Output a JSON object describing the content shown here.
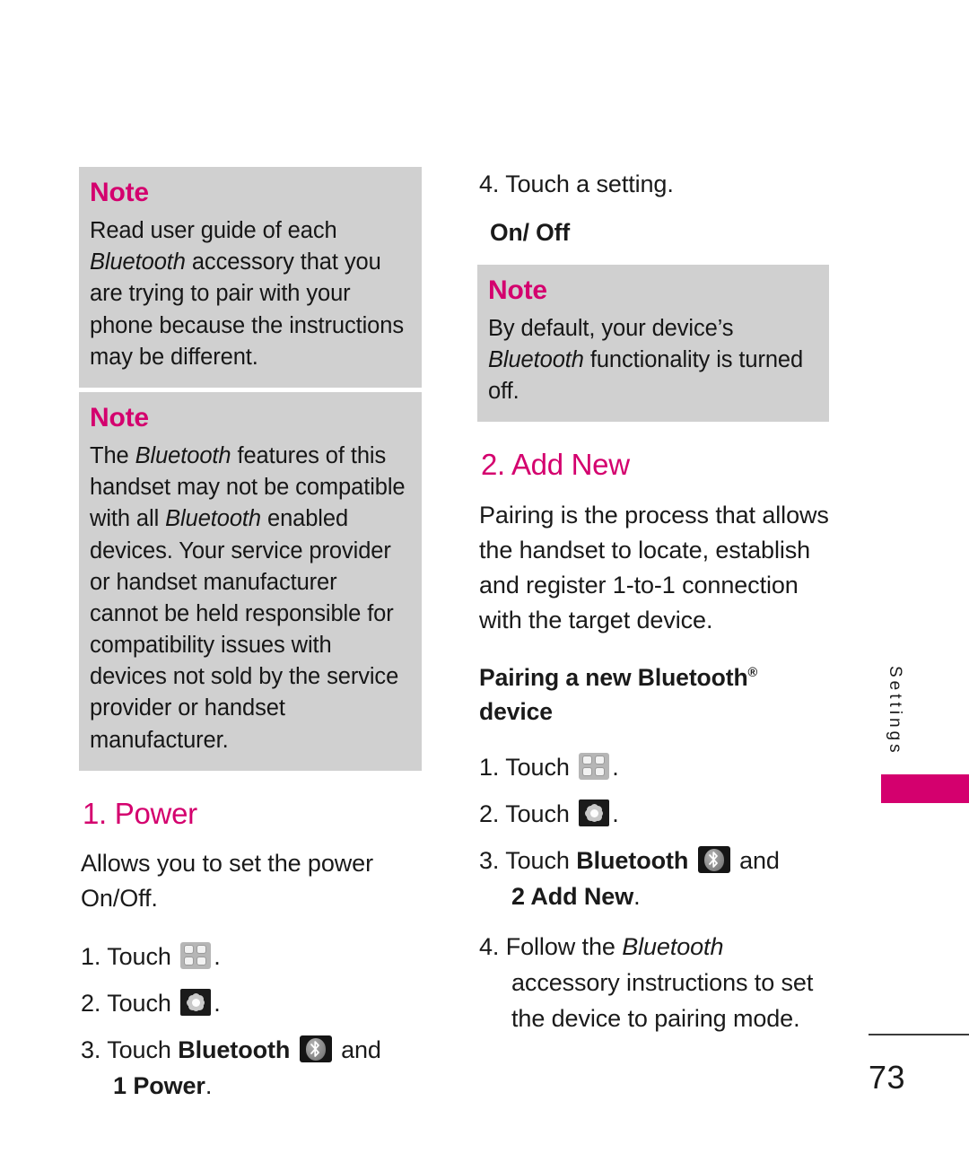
{
  "document": {
    "page_number": "73",
    "side_tab_label": "Settings",
    "accent_color": "#d4006e",
    "note_bg_color": "#d0d0d0"
  },
  "left_column": {
    "notes": [
      {
        "title": "Note",
        "body_before": "Read user guide of each ",
        "body_italic": "Bluetooth",
        "body_after": " accessory that you are trying to pair with your phone because the instructions may be different."
      },
      {
        "title": "Note",
        "seg1": "The ",
        "it1": "Bluetooth",
        "seg2": " features of this handset may not be compatible with all ",
        "it2": "Bluetooth",
        "seg3": " enabled devices. Your service provider or handset manufacturer cannot be held responsible for compatibility issues with devices not sold by the service provider or handset manufacturer."
      }
    ],
    "heading": "1. Power",
    "intro": "Allows you to set the power On/Off.",
    "steps": [
      {
        "num": "1. Touch",
        "icon": "menu-grid-icon",
        "tail": "."
      },
      {
        "num": "2. Touch",
        "icon": "gear-settings-icon",
        "tail": "."
      },
      {
        "num": "3. Touch",
        "bold": "Bluetooth",
        "icon": "bluetooth-icon",
        "after_icon": "and",
        "continuation_bold": "1 Power",
        "continuation_tail": "."
      }
    ]
  },
  "right_column": {
    "step4": "4. Touch a setting.",
    "setting_option": "On/ Off",
    "note": {
      "title": "Note",
      "seg1": "By default, your device’s ",
      "it1": "Bluetooth",
      "seg2": " functionality is turned off."
    },
    "heading": "2. Add New",
    "intro": "Pairing is the process that allows the handset to locate, establish and register 1-to-1 connection with the target device.",
    "subheading": "Pairing a new Bluetooth",
    "subheading_sup": "®",
    "subheading_line2": "device",
    "steps": [
      {
        "num": "1. Touch",
        "icon": "menu-grid-icon",
        "tail": "."
      },
      {
        "num": "2. Touch",
        "icon": "gear-settings-icon",
        "tail": "."
      },
      {
        "num": "3. Touch",
        "bold": "Bluetooth",
        "icon": "bluetooth-icon",
        "after_icon": "and",
        "continuation_bold": "2 Add New",
        "continuation_tail": "."
      },
      {
        "num": "4. Follow the ",
        "italic": "Bluetooth",
        "continuation": "accessory instructions to set the device to pairing mode."
      }
    ]
  }
}
